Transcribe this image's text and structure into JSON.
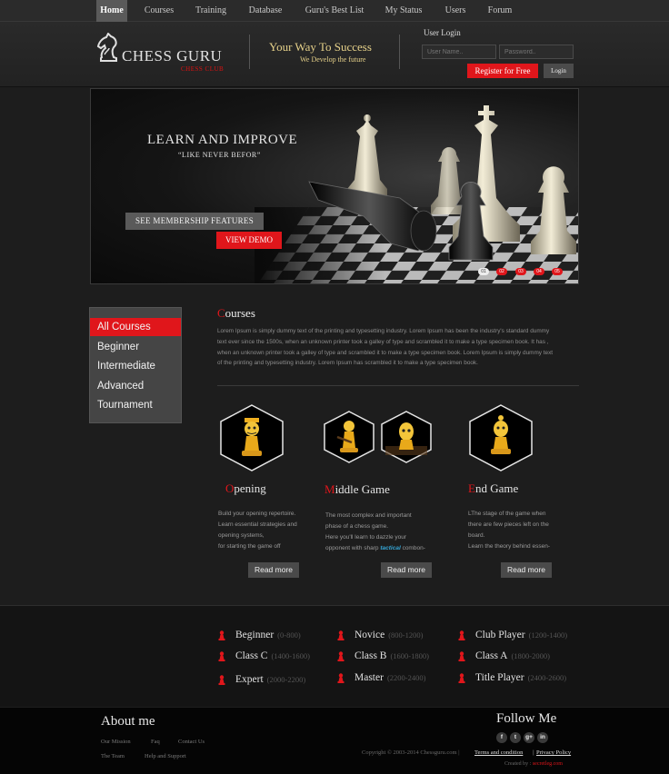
{
  "nav": {
    "items": [
      {
        "label": "Home",
        "active": true
      },
      {
        "label": "Courses"
      },
      {
        "label": "Training"
      },
      {
        "label": "Database"
      },
      {
        "label": "Guru's Best List"
      },
      {
        "label": "My Status"
      },
      {
        "label": "Users"
      },
      {
        "label": "Forum"
      }
    ]
  },
  "header": {
    "logo_name": "CHESS GURU",
    "logo_sub": "CHESS CLUB",
    "tagline": "Your Way To Success",
    "tagline_sub": "We Develop the future",
    "login": {
      "title": "User Login",
      "username_placeholder": "User Name..",
      "password_placeholder": "Password..",
      "register_label": "Register for Free",
      "login_label": "Login"
    }
  },
  "hero": {
    "title": "LEARN AND IMPROVE",
    "subtitle": "“LIKE NEVER  BEFOR”",
    "membership_label": "SEE MEMBERSHIP FEATURES",
    "demo_label": "VIEW DEMO",
    "slides": [
      "01",
      "02",
      "03",
      "04",
      "05"
    ],
    "active_slide": "01"
  },
  "sidebar": {
    "items": [
      {
        "label": "All Courses",
        "active": true
      },
      {
        "label": "Beginner"
      },
      {
        "label": "Intermediate"
      },
      {
        "label": "Advanced"
      },
      {
        "label": "Tournament"
      }
    ]
  },
  "courses": {
    "title_initial": "C",
    "title_rest": "ourses",
    "intro_lines": [
      "Lorem Ipsum is simply dummy text of the printing and typesetting industry. Lorem Ipsum has been the industry's standard dummy",
      "text ever since the 1500s, when an unknown printer took a galley of type and scrambled it to make a type specimen book. It has ,",
      " when an unknown printer took a galley of type and scrambled it to make a type specimen book. Lorem Ipsum is simply dummy text",
      "of the printing and typesetting industry. Lorem Ipsum has scrambled it to make a type specimen book."
    ],
    "columns": [
      {
        "title_initial": "O",
        "title_rest": "pening",
        "lines": [
          "Build your opening repertoire.",
          "Learn essential strategies and",
          "opening systems,",
          "for starting the game off"
        ],
        "button": "Read more"
      },
      {
        "title_initial": "M",
        "title_rest": "iddle Game",
        "lines": [
          "The most complex and important",
          "phase of a chess game.",
          "Here you'll learn to dazzle your"
        ],
        "line4_before": "opponent with sharp ",
        "line4_highlight": "tactical",
        "line4_after": " combon-",
        "button": "Read more"
      },
      {
        "title_initial": "E",
        "title_rest": "nd Game",
        "lines": [
          "LThe stage of the game when",
          "there are few pieces left on the",
          "board.",
          "Learn the theory behind essen-"
        ],
        "button": "Read more"
      }
    ]
  },
  "ranks": [
    {
      "name": "Beginner",
      "range": "(0-800)"
    },
    {
      "name": "Novice",
      "range": "(800-1200)"
    },
    {
      "name": "Club Player",
      "range": "(1200-1400)"
    },
    {
      "name": "Class C",
      "range": "(1400-1600)"
    },
    {
      "name": "Class B",
      "range": "(1600-1800)"
    },
    {
      "name": "Class A",
      "range": "(1800-2000)"
    },
    {
      "name": "Expert",
      "range": "(2000-2200)"
    },
    {
      "name": "Master",
      "range": "(2200-2400)"
    },
    {
      "name": "Title Player",
      "range": "(2400-2600)"
    }
  ],
  "footer": {
    "about_title": "About me",
    "links": [
      "Our Mission",
      "Faq",
      "Contact Us",
      "The Team",
      "Help and Support"
    ],
    "follow_title": "Follow Me",
    "social": [
      "f",
      "t",
      "g+",
      "in"
    ],
    "copyright": "Copyright © 2003-2014 Chessguru.com  |",
    "terms": "Terms and condition",
    "privacy": "Privacy Policy",
    "created_by": "Created by :",
    "created_brand": "secretleg.com"
  },
  "colors": {
    "accent": "#e0161b",
    "gold": "#e5d089",
    "background": "#1d1d1d"
  }
}
